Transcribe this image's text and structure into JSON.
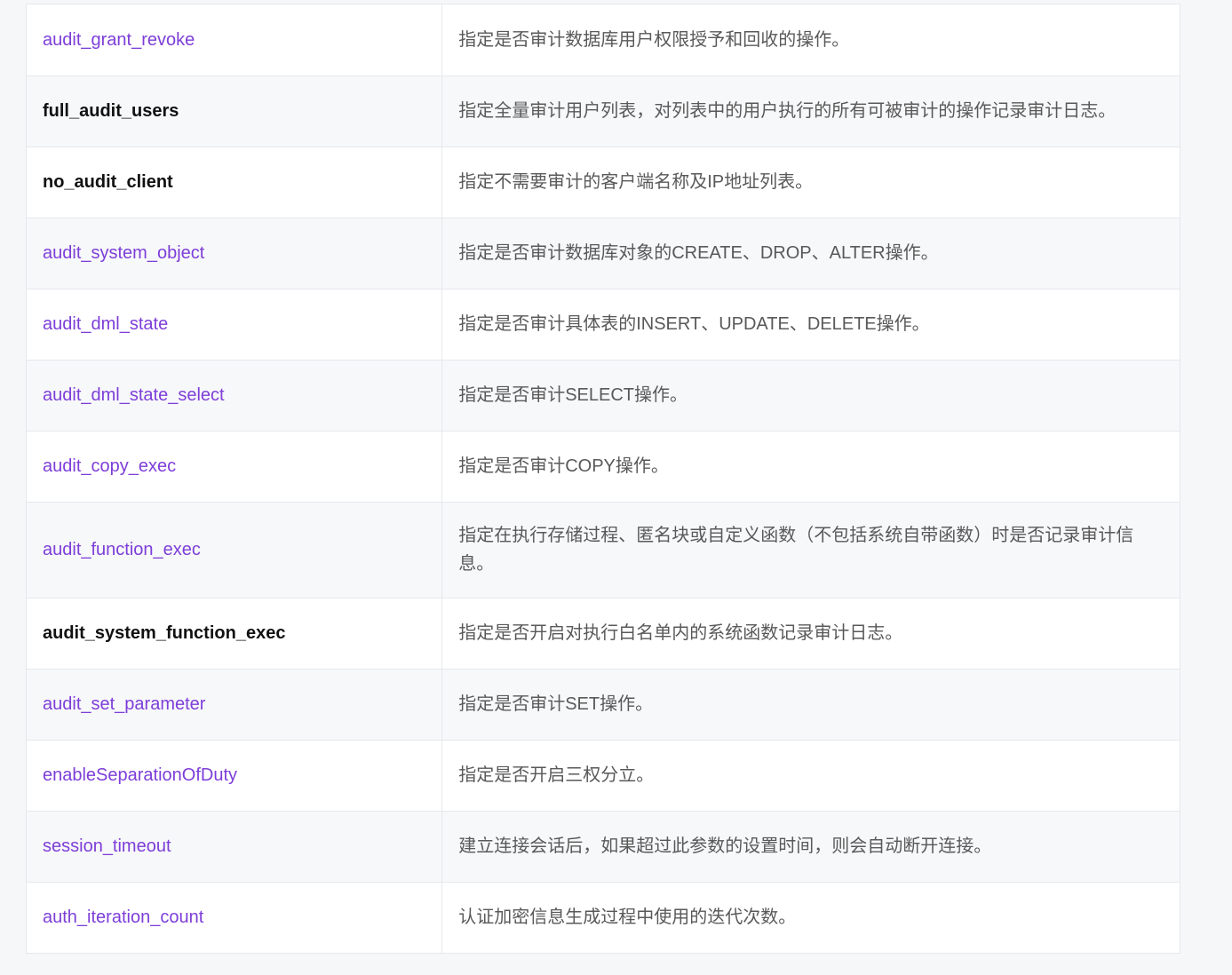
{
  "table": {
    "rows": [
      {
        "name": "audit_grant_revoke",
        "is_link": true,
        "desc": "指定是否审计数据库用户权限授予和回收的操作。"
      },
      {
        "name": "full_audit_users",
        "is_link": false,
        "desc": "指定全量审计用户列表，对列表中的用户执行的所有可被审计的操作记录审计日志。"
      },
      {
        "name": "no_audit_client",
        "is_link": false,
        "desc": "指定不需要审计的客户端名称及IP地址列表。"
      },
      {
        "name": "audit_system_object",
        "is_link": true,
        "desc": "指定是否审计数据库对象的CREATE、DROP、ALTER操作。"
      },
      {
        "name": "audit_dml_state",
        "is_link": true,
        "desc": "指定是否审计具体表的INSERT、UPDATE、DELETE操作。"
      },
      {
        "name": "audit_dml_state_select",
        "is_link": true,
        "desc": "指定是否审计SELECT操作。"
      },
      {
        "name": "audit_copy_exec",
        "is_link": true,
        "desc": "指定是否审计COPY操作。"
      },
      {
        "name": "audit_function_exec",
        "is_link": true,
        "desc": "指定在执行存储过程、匿名块或自定义函数（不包括系统自带函数）时是否记录审计信息。"
      },
      {
        "name": "audit_system_function_exec",
        "is_link": false,
        "desc": "指定是否开启对执行白名单内的系统函数记录审计日志。"
      },
      {
        "name": "audit_set_parameter",
        "is_link": true,
        "desc": "指定是否审计SET操作。"
      },
      {
        "name": "enableSeparationOfDuty",
        "is_link": true,
        "desc": "指定是否开启三权分立。"
      },
      {
        "name": "session_timeout",
        "is_link": true,
        "desc": "建立连接会话后，如果超过此参数的设置时间，则会自动断开连接。"
      },
      {
        "name": "auth_iteration_count",
        "is_link": true,
        "desc": "认证加密信息生成过程中使用的迭代次数。"
      }
    ]
  },
  "colors": {
    "link": "#7d3ed8",
    "bold_text": "#111111",
    "desc_text": "#595959",
    "border": "#e6e8eb",
    "row_alt": "#f7f8fa"
  }
}
